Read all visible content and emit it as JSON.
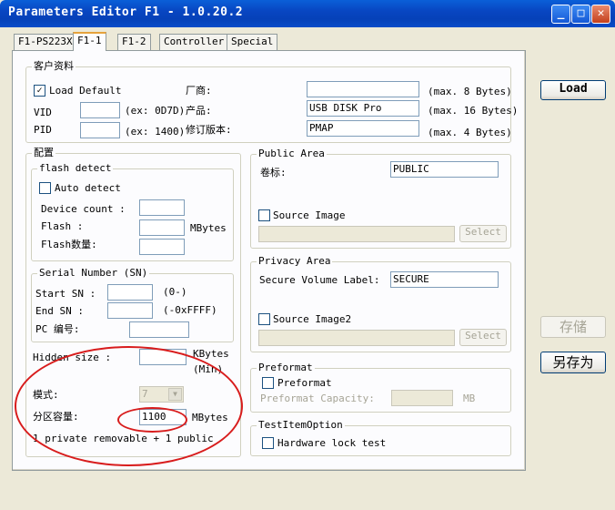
{
  "window": {
    "title": "Parameters Editor F1 - 1.0.20.2",
    "minimize": "_",
    "maximize": "□",
    "close": "✕"
  },
  "tabs": [
    "F1-PS223X",
    "F1-1",
    "F1-2",
    "Controller",
    "Special"
  ],
  "customer": {
    "group_label": "客户资料",
    "load_default": "Load Default",
    "load_default_checked": "✓",
    "vid_label": "VID",
    "vid_value": "",
    "vid_hint": "(ex: 0D7D)",
    "pid_label": "PID",
    "pid_value": "",
    "pid_hint": "(ex: 1400)",
    "vendor_label": "厂商:",
    "vendor_value": "",
    "vendor_hint": "(max. 8 Bytes)",
    "product_label": "产品:",
    "product_value": "USB DISK Pro",
    "product_hint": "(max. 16 Bytes)",
    "revision_label": "修订版本:",
    "revision_value": "PMAP",
    "revision_hint": "(max. 4 Bytes)"
  },
  "config": {
    "group_label": "配置",
    "flash_detect": {
      "group_label": "flash detect",
      "auto_detect": "Auto detect",
      "device_count_label": "Device count :",
      "flash_label": "Flash  :",
      "flash_unit": "MBytes",
      "flash_count_label": "Flash数量:"
    },
    "serial": {
      "group_label": "Serial Number (SN)",
      "start_label": "Start SN :",
      "start_hint": "(0-)",
      "end_label": "End SN  :",
      "end_hint": "(-0xFFFF)",
      "pc_label": "PC 编号:"
    },
    "hidden_label": "Hidden size :",
    "hidden_unit": "KBytes",
    "hidden_min": "(Min)",
    "mode_label": "模式:",
    "mode_value": "7",
    "partition_label": "分区容量:",
    "partition_value": "1100",
    "partition_unit": "MBytes",
    "partition_note": "1 private removable + 1 public"
  },
  "public_area": {
    "group_label": "Public Area",
    "volume_label": "卷标:",
    "volume_value": "PUBLIC",
    "source_image": "Source Image",
    "select": "Select"
  },
  "privacy_area": {
    "group_label": "Privacy Area",
    "secure_label": "Secure Volume Label:",
    "secure_value": "SECURE",
    "source_image2": "Source Image2",
    "select": "Select"
  },
  "preformat": {
    "group_label": "Preformat",
    "checkbox": "Preformat",
    "capacity_label": "Preformat Capacity:",
    "capacity_unit": "MB"
  },
  "test_item": {
    "group_label": "TestItemOption",
    "hardware_lock": "Hardware lock test"
  },
  "side_buttons": {
    "load": "Load",
    "save": "存储",
    "save_as": "另存为"
  },
  "colors": {
    "annotation": "#d81c1c",
    "titlebar": "#0846c2"
  }
}
